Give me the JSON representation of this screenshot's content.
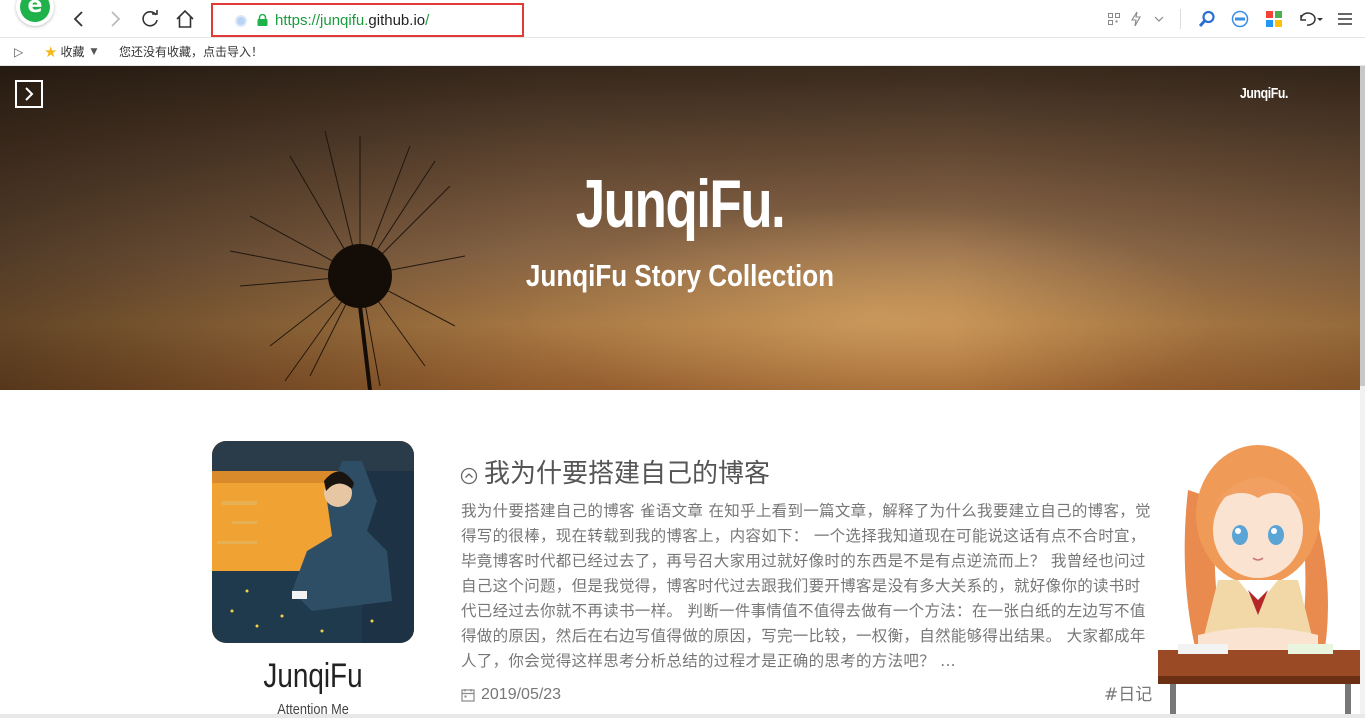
{
  "browser": {
    "url_prefix": "https://junqifu.",
    "url_domain": "github.io",
    "url_suffix": "/"
  },
  "bookmarks": {
    "favorites_label": "收藏",
    "empty_hint": "您还没有收藏，点击导入！"
  },
  "hero": {
    "brand": "JunqiFu.",
    "title": "JunqiFu.",
    "subtitle": "JunqiFu Story Collection"
  },
  "profile": {
    "name": "JunqiFu",
    "tagline": "Attention Me"
  },
  "post": {
    "title": "我为什要搭建自己的博客",
    "excerpt": "我为什要搭建自己的博客 雀语文章 在知乎上看到一篇文章，解释了为什么我要建立自己的博客，觉得写的很棒，现在转载到我的博客上，内容如下：  一个选择我知道现在可能说这话有点不合时宜，毕竟博客时代都已经过去了，再号召大家用过就好像时的东西是不是有点逆流而上？ 我曾经也问过自己这个问题，但是我觉得，博客时代过去跟我们要开博客是没有多大关系的，就好像你的读书时代已经过去你就不再读书一样。 判断一件事情值不值得去做有一个方法：在一张白纸的左边写不值得做的原因，然后在右边写值得做的原因，写完一比较，一权衡，自然能够得出结果。 大家都成年人了，你会觉得这样思考分析总结的过程才是正确的思考的方法吧？ ...",
    "date": "2019/05/23",
    "tag": "#日记"
  },
  "colors": {
    "url_green": "#1a9c3e",
    "address_highlight": "#e03a3a",
    "browser_brand": "#1fb14a"
  }
}
